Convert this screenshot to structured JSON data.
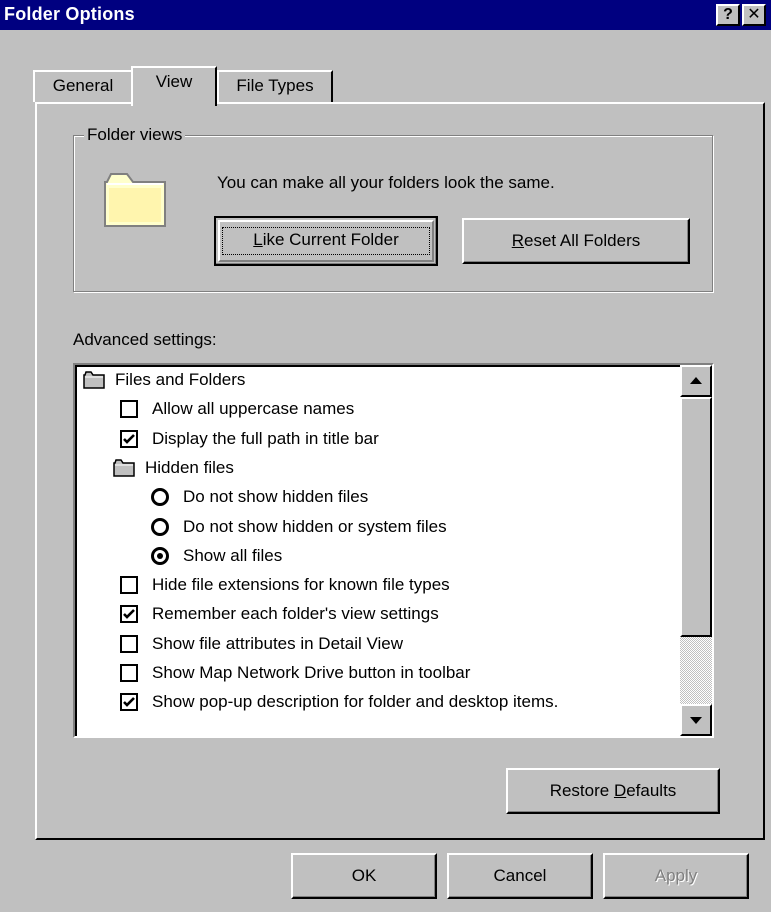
{
  "window": {
    "title": "Folder Options",
    "help_glyph": "?",
    "close_glyph": "✕"
  },
  "tabs": [
    {
      "label": "General",
      "active": false
    },
    {
      "label": "View",
      "active": true
    },
    {
      "label": "File Types",
      "active": false
    }
  ],
  "folder_views": {
    "group_label": "Folder views",
    "description": "You can make all your folders look the same.",
    "like_current_hotkey": "L",
    "like_current_rest": "ike Current Folder",
    "reset_hotkey": "R",
    "reset_rest": "eset All Folders"
  },
  "advanced": {
    "label": "Advanced settings:",
    "items": [
      {
        "type": "folder",
        "text": "Files and Folders"
      },
      {
        "type": "checkbox",
        "checked": false,
        "text": "Allow all uppercase names"
      },
      {
        "type": "checkbox",
        "checked": true,
        "text": "Display the full path in title bar"
      },
      {
        "type": "folder",
        "text": "Hidden files"
      },
      {
        "type": "radio",
        "checked": false,
        "text": "Do not show hidden files"
      },
      {
        "type": "radio",
        "checked": false,
        "text": "Do not show hidden or system files"
      },
      {
        "type": "radio",
        "checked": true,
        "text": "Show all files"
      },
      {
        "type": "checkbox",
        "checked": false,
        "text": "Hide file extensions for known file types"
      },
      {
        "type": "checkbox",
        "checked": true,
        "text": "Remember each folder's view settings"
      },
      {
        "type": "checkbox",
        "checked": false,
        "text": "Show file attributes in Detail View"
      },
      {
        "type": "checkbox",
        "checked": false,
        "text": "Show Map Network Drive button in toolbar"
      },
      {
        "type": "checkbox",
        "checked": true,
        "text": "Show pop-up description for folder and desktop items."
      }
    ]
  },
  "buttons": {
    "restore_pre": "Restore ",
    "restore_hotkey": "D",
    "restore_post": "efaults",
    "ok": "OK",
    "cancel": "Cancel",
    "apply": "Apply",
    "apply_enabled": false
  },
  "colors": {
    "titlebar": "#000080",
    "face": "#c0c0c0",
    "folder": "#ffffcc"
  }
}
